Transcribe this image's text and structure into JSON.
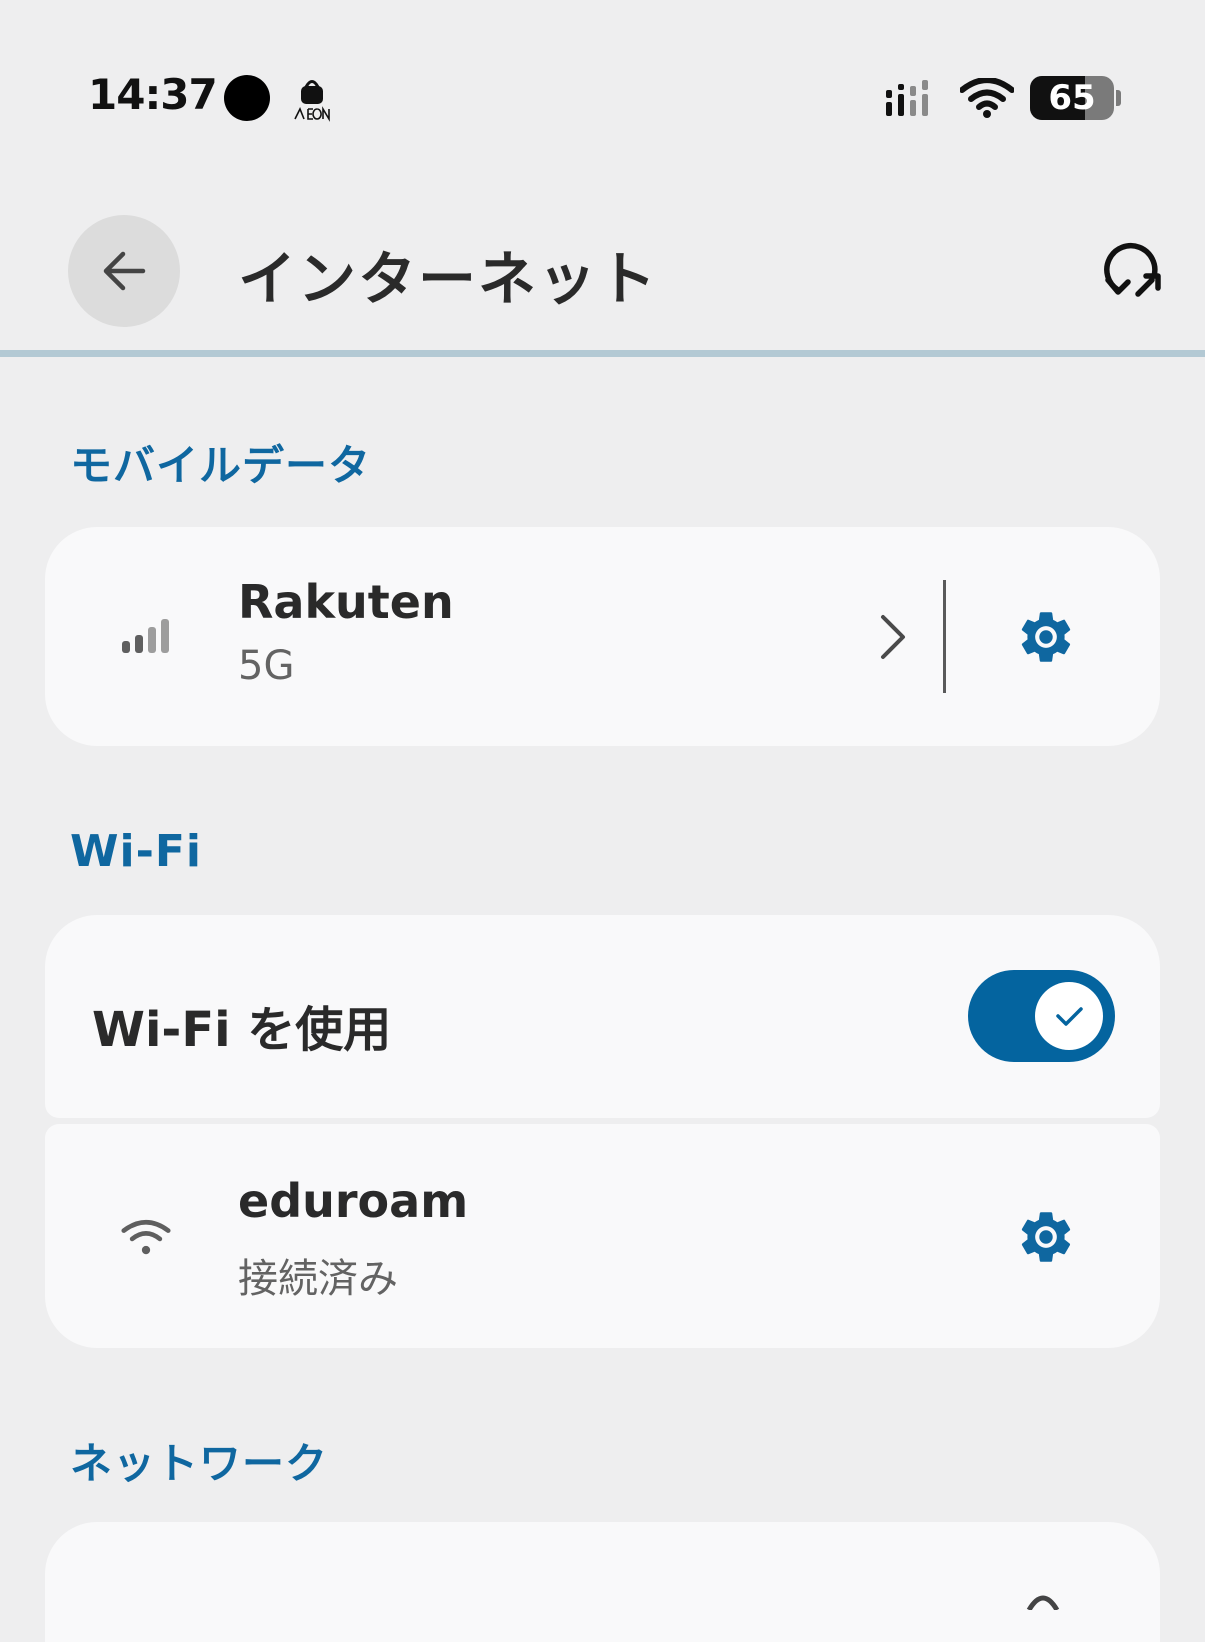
{
  "status_bar": {
    "time": "14:37",
    "battery_level": "65",
    "battery_fraction": 0.65,
    "icons": [
      "recording-dot-icon",
      "aeon-app-icon",
      "dual-sim-signal-icon",
      "wifi-icon",
      "battery-icon"
    ]
  },
  "app_bar": {
    "title": "インターネット",
    "back_icon": "arrow-left-icon",
    "reset_icon": "network-reset-icon"
  },
  "sections": {
    "mobile_data": {
      "header": "モバイルデータ",
      "carrier": "Rakuten",
      "network_type": "5G",
      "icons": [
        "signal-bars-icon",
        "chevron-right-icon",
        "gear-icon"
      ]
    },
    "wifi": {
      "header": "Wi-Fi",
      "toggle_label": "Wi-Fi を使用",
      "toggle_on": true,
      "network_name": "eduroam",
      "network_status": "接続済み",
      "icons": [
        "wifi-icon",
        "gear-icon",
        "check-icon"
      ]
    },
    "network": {
      "header": "ネットワーク"
    }
  },
  "colors": {
    "accent": "#0f67a0",
    "toggle_track": "#04649f",
    "background": "#eeeeef",
    "card": "#f9f9fa"
  }
}
